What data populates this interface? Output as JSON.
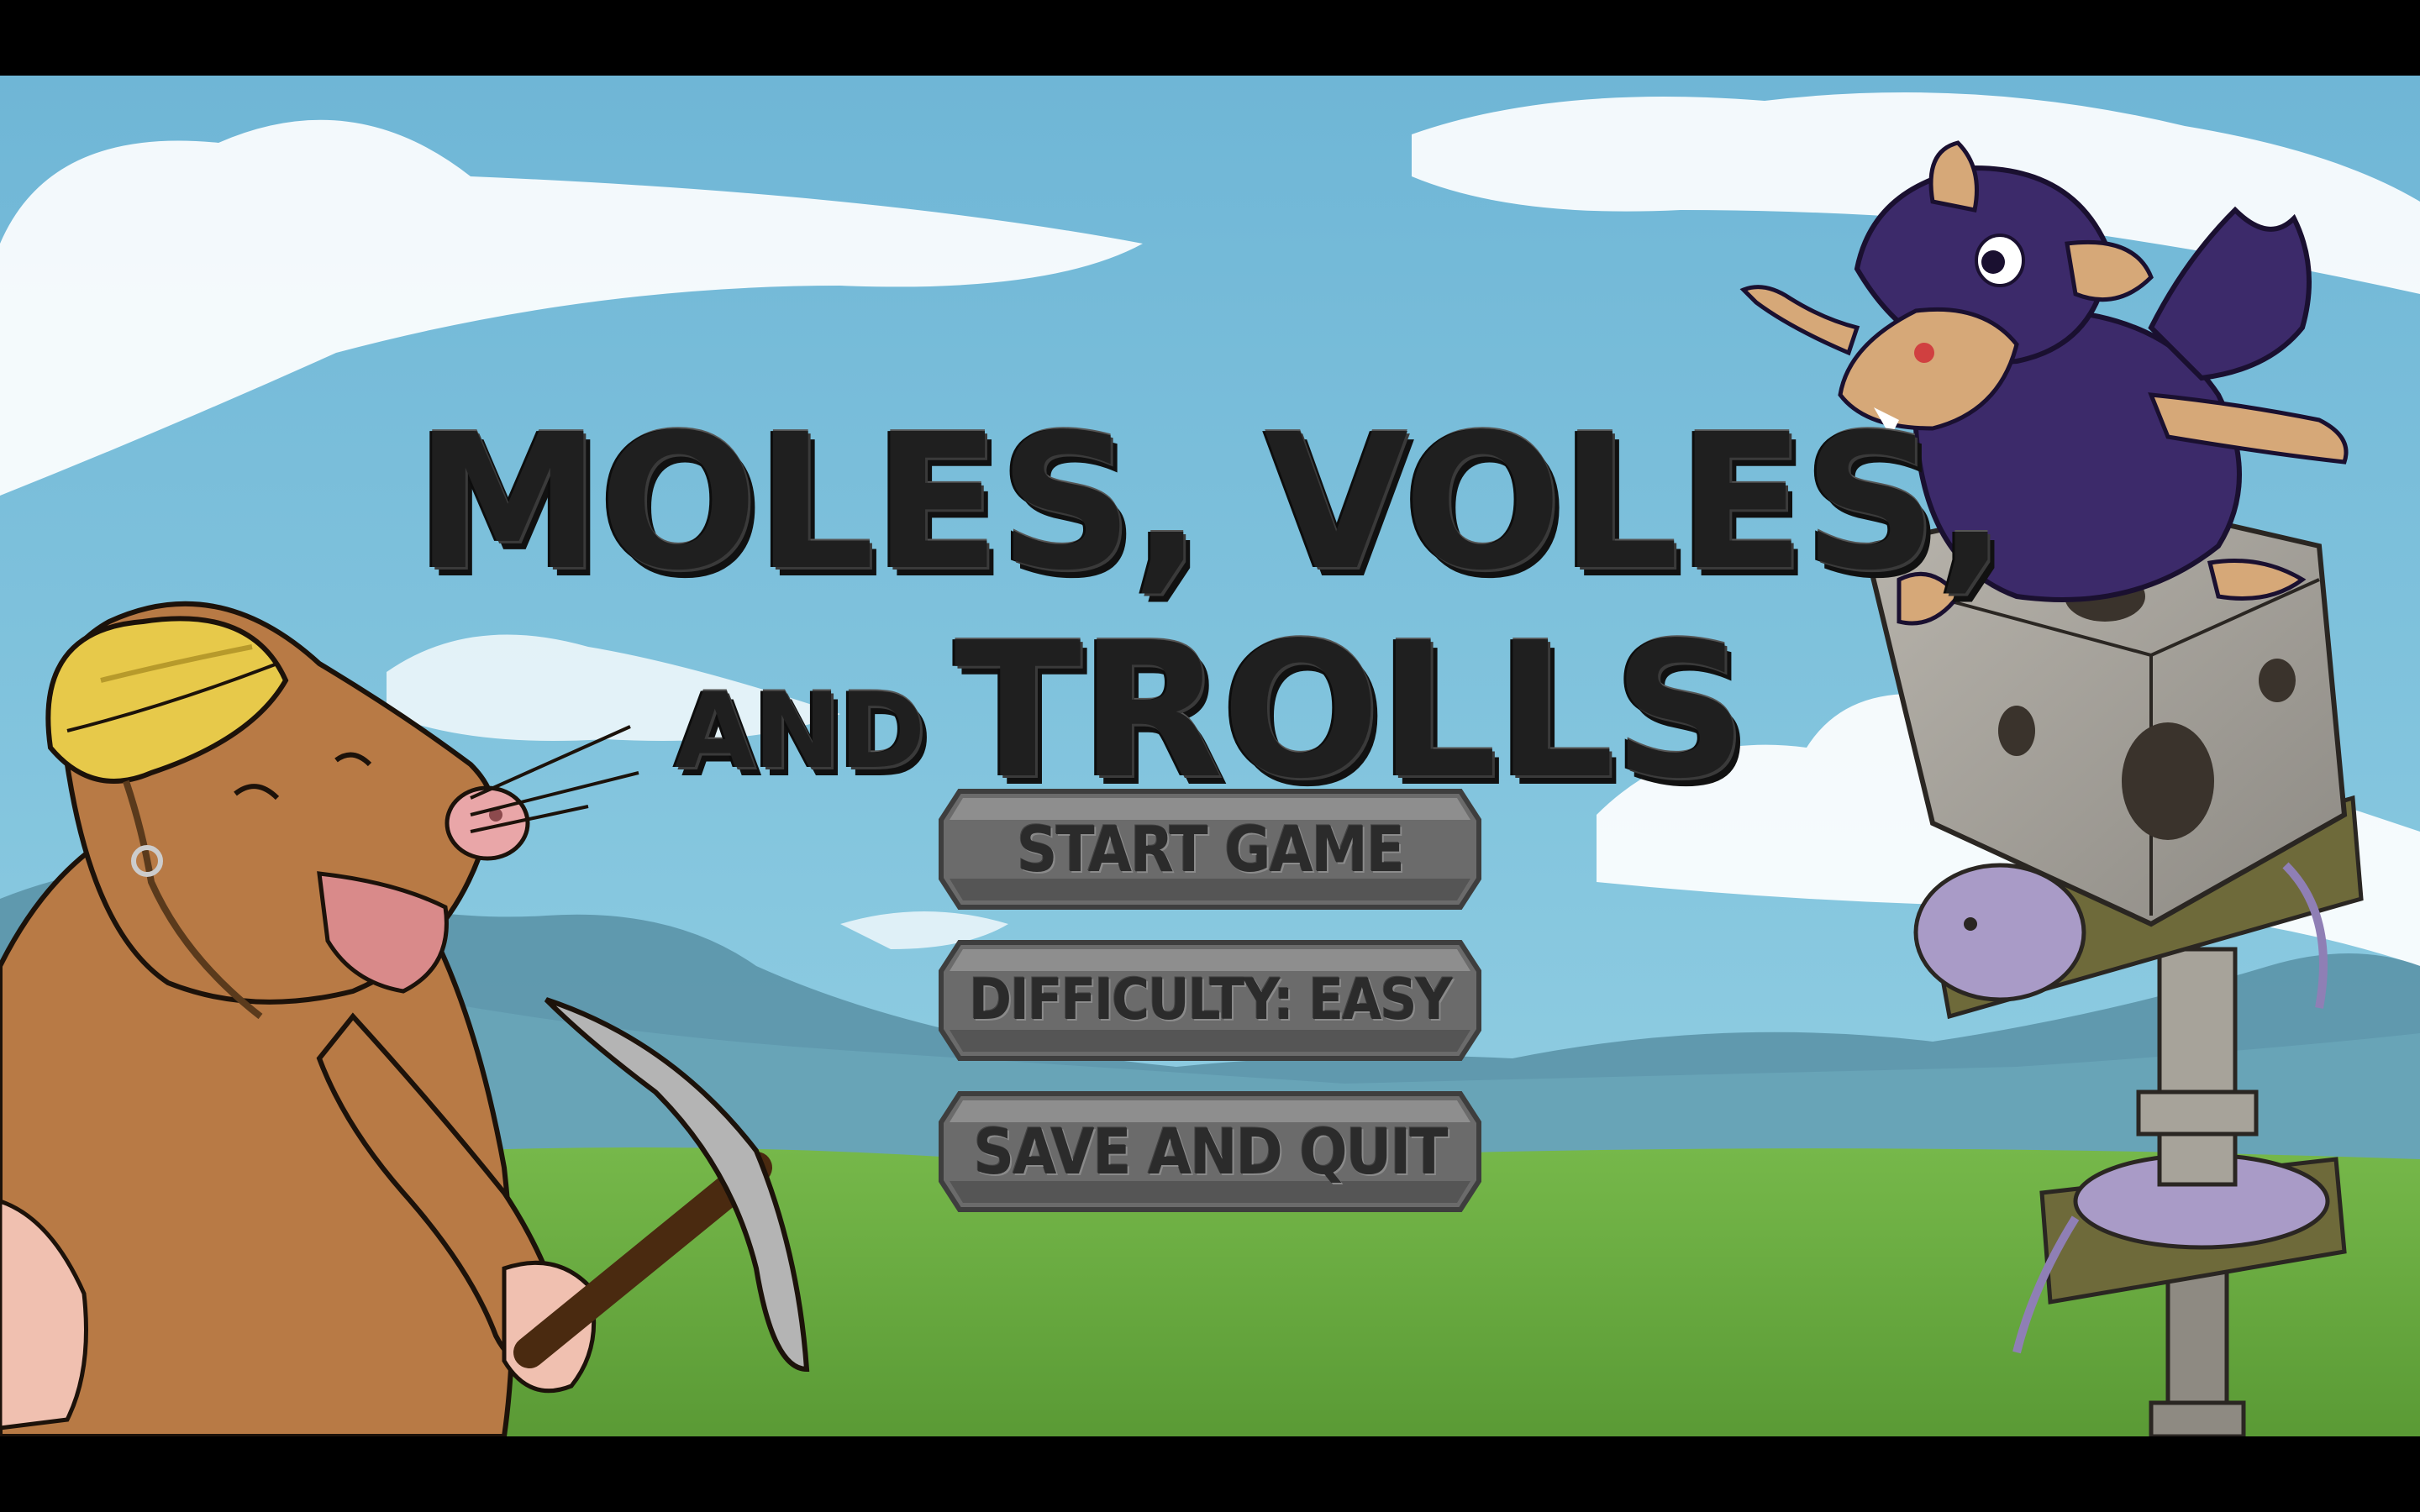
{
  "game": {
    "title_line1": "MOLES, VOLES,",
    "title_line2_small": "AND",
    "title_line2_large": "TROLLS"
  },
  "menu": {
    "start_label": "START GAME",
    "difficulty_label": "DIFFICULTY: EASY",
    "quit_label": "SAVE AND QUIT"
  },
  "colors": {
    "letterbox": "#000000",
    "sky": "#7fc2dc",
    "grass": "#6aae3f",
    "button_stone": "#6b6b6b",
    "button_edge": "#8e8e8e",
    "title_ink": "#1f1f1f"
  },
  "icons": {
    "left_character": "miner-mole-with-pickaxe",
    "right_character": "caped-vole-on-rock-tower"
  }
}
